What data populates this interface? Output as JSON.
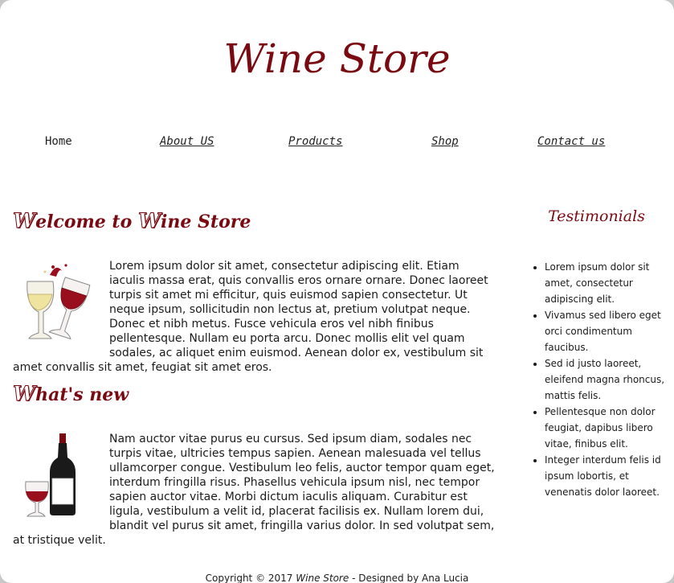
{
  "header": {
    "title": "Wine Store"
  },
  "nav": {
    "items": [
      "Home",
      "About US",
      "Products",
      "Shop",
      "Contact us"
    ]
  },
  "main": {
    "welcome": {
      "title_cap1": "W",
      "title_mid": "elcome to ",
      "title_cap2": "W",
      "title_end": "ine Store",
      "paragraph": "Lorem ipsum dolor sit amet, consectetur adipiscing elit. Etiam iaculis massa erat, quis convallis eros ornare ornare. Donec laoreet turpis sit amet mi efficitur, quis euismod sapien consectetur. Ut neque ipsum, sollicitudin non lectus at, pretium volutpat neque. Donec et nibh metus. Fusce vehicula eros vel nibh finibus pellentesque. Nullam eu porta arcu. Donec mollis elit vel quam sodales, ac aliquet enim euismod. Aenean dolor ex, vestibulum sit amet convallis sit amet, feugiat sit amet eros.",
      "image_icon": "wine-glasses-icon"
    },
    "whats_new": {
      "title_cap": "W",
      "title_rest": "hat's new",
      "paragraph": "Nam auctor vitae purus eu cursus. Sed ipsum diam, sodales nec turpis vitae, ultricies tempus sapien. Aenean malesuada vel tellus ullamcorper congue. Vestibulum leo felis, auctor tempor quam eget, interdum fringilla risus. Phasellus vehicula ipsum nisl, nec tempor sapien auctor vitae. Morbi dictum iaculis aliquam. Curabitur est ligula, vestibulum a velit id, placerat facilisis ex. Nullam lorem dui, blandit vel purus sit amet, fringilla varius dolor. In sed volutpat sem, at tristique velit.",
      "image_icon": "wine-bottle-icon"
    }
  },
  "sidebar": {
    "title": "Testimonials",
    "items": [
      "Lorem ipsum dolor sit amet, consectetur adipiscing elit.",
      "Vivamus sed libero eget orci condimentum faucibus.",
      "Sed id justo laoreet, eleifend magna rhoncus, mattis felis.",
      "Pellentesque non dolor feugiat, dapibus libero vitae, finibus elit.",
      "Integer interdum felis id ipsum lobortis, et venenatis dolor laoreet."
    ]
  },
  "footer": {
    "copyright": "Copyright © 2017",
    "brand": "Wine Store",
    "designer": "-  Designed by Ana Lucia"
  },
  "colors": {
    "accent": "#7a0a12",
    "text": "#1b1b1b",
    "background": "#ffffff"
  }
}
